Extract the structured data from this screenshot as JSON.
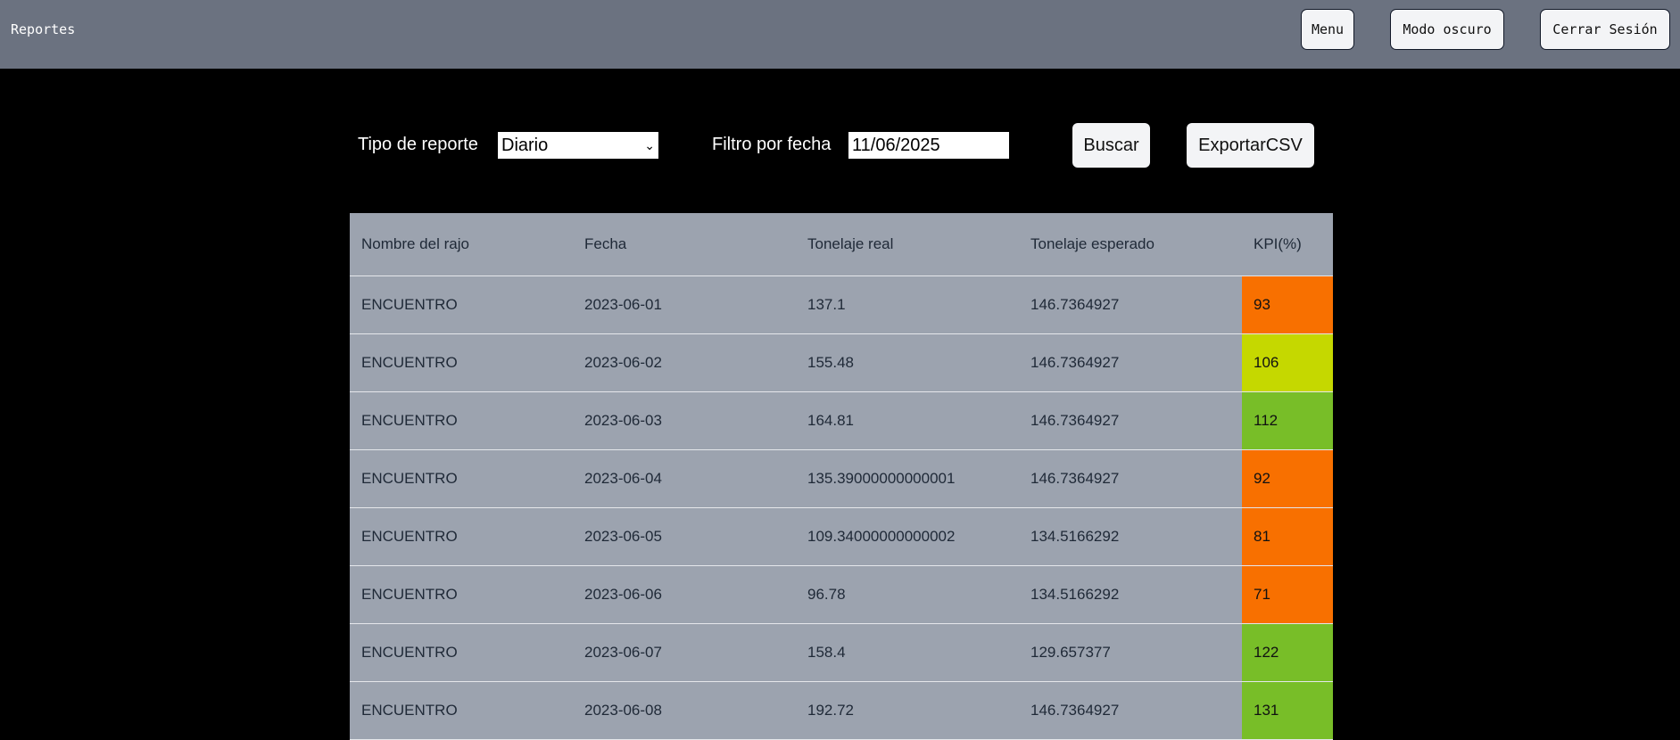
{
  "header": {
    "title": "Reportes",
    "menu": "Menu",
    "dark_mode": "Modo oscuro",
    "logout": "Cerrar Sesión"
  },
  "controls": {
    "type_label": "Tipo de reporte",
    "type_value": "Diario",
    "date_label": "Filtro por fecha",
    "date_value": "11/06/2025",
    "search": "Buscar",
    "export": "ExportarCSV"
  },
  "colors": {
    "low": "#f87000",
    "mid": "#c5d800",
    "high": "#78be28"
  },
  "table": {
    "headers": [
      "Nombre del rajo",
      "Fecha",
      "Tonelaje real",
      "Tonelaje esperado",
      "KPI(%)"
    ],
    "rows": [
      [
        "ENCUENTRO",
        "2023-06-01",
        "137.1",
        "146.7364927",
        "93",
        "low"
      ],
      [
        "ENCUENTRO",
        "2023-06-02",
        "155.48",
        "146.7364927",
        "106",
        "mid"
      ],
      [
        "ENCUENTRO",
        "2023-06-03",
        "164.81",
        "146.7364927",
        "112",
        "high"
      ],
      [
        "ENCUENTRO",
        "2023-06-04",
        "135.39000000000001",
        "146.7364927",
        "92",
        "low"
      ],
      [
        "ENCUENTRO",
        "2023-06-05",
        "109.34000000000002",
        "134.5166292",
        "81",
        "low"
      ],
      [
        "ENCUENTRO",
        "2023-06-06",
        "96.78",
        "134.5166292",
        "71",
        "low"
      ],
      [
        "ENCUENTRO",
        "2023-06-07",
        "158.4",
        "129.657377",
        "122",
        "high"
      ],
      [
        "ENCUENTRO",
        "2023-06-08",
        "192.72",
        "146.7364927",
        "131",
        "high"
      ]
    ]
  }
}
